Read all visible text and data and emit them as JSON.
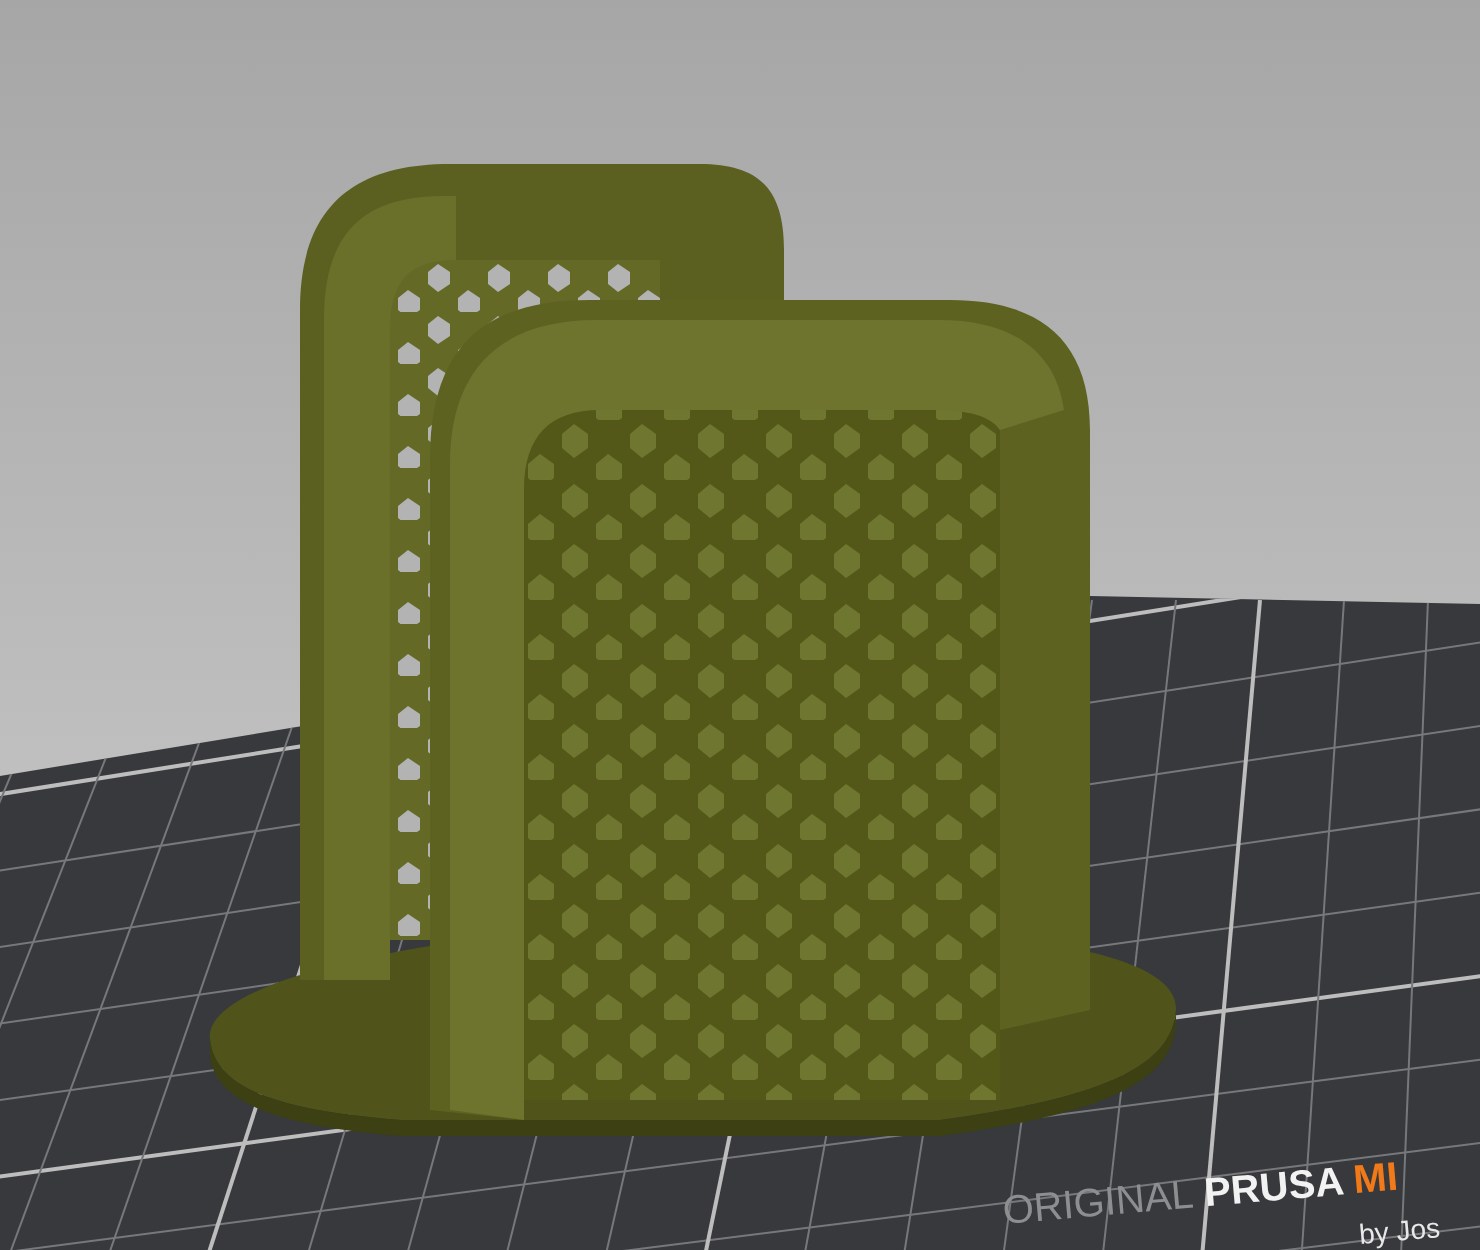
{
  "viewport": {
    "bed_label": [
      {
        "text": "ORIGINAL",
        "kind": "plain"
      },
      {
        "text": "PRUSA",
        "kind": "bold"
      },
      {
        "text": "MI",
        "kind": "accent"
      }
    ],
    "bed_sublabel": "by Jos"
  }
}
